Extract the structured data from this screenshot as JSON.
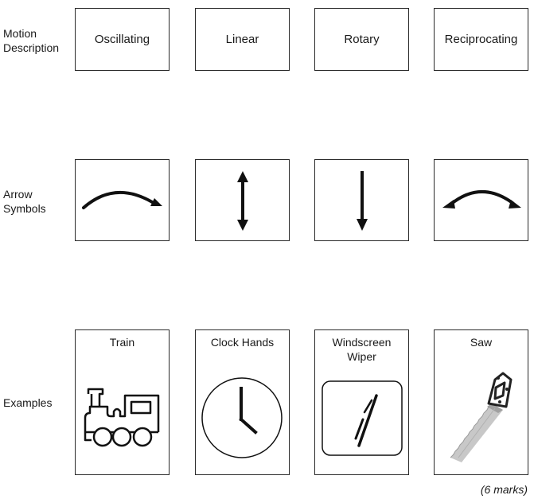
{
  "row_labels": {
    "motion": [
      "Motion",
      "Description"
    ],
    "arrows": [
      "Arrow",
      "Symbols"
    ],
    "examples": "Examples"
  },
  "descriptions": [
    "Oscillating",
    "Linear",
    "Rotary",
    "Reciprocating"
  ],
  "arrow_symbols": [
    {
      "icon": "curved-arrow-right-icon"
    },
    {
      "icon": "double-headed-vertical-arrow-icon"
    },
    {
      "icon": "downward-arrow-icon"
    },
    {
      "icon": "double-headed-curved-arrow-icon"
    }
  ],
  "examples": [
    {
      "title": "Train",
      "icon": "steam-train-icon"
    },
    {
      "title": "Clock Hands",
      "icon": "clock-icon"
    },
    {
      "title_lines": [
        "Windscreen",
        "Wiper"
      ],
      "icon": "windscreen-wiper-icon"
    },
    {
      "title": "Saw",
      "icon": "saw-icon"
    }
  ],
  "marks": "(6 marks)"
}
